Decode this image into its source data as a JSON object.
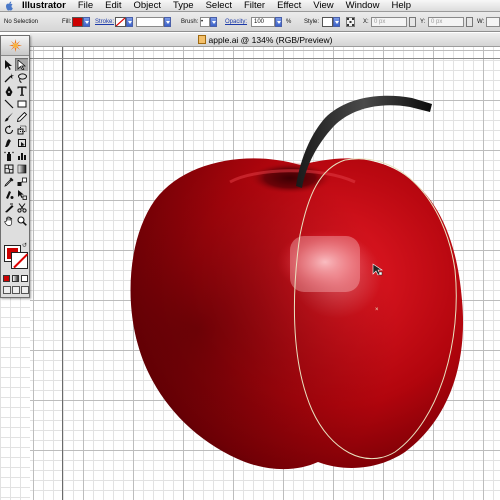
{
  "menubar": {
    "app_name": "Illustrator",
    "items": [
      "File",
      "Edit",
      "Object",
      "Type",
      "Select",
      "Filter",
      "Effect",
      "View",
      "Window",
      "Help"
    ]
  },
  "control": {
    "selection_status": "No Selection",
    "fill_label": "Fill:",
    "stroke_label": "Stroke:",
    "brush_label": "Brush:",
    "opacity_label": "Opacity:",
    "opacity_value": "100",
    "percent": "%",
    "style_label": "Style:",
    "x_label": "X:",
    "x_value": "0 px",
    "y_label": "Y:",
    "y_value": "0 px",
    "w_label": "W:",
    "fill_color": "#cc0000"
  },
  "document": {
    "title": "apple.ai @ 134% (RGB/Preview)"
  },
  "tools": {
    "fill_color": "#cc0000",
    "stroke_color": "#ffffff",
    "icons": [
      "selection-tool",
      "direct-selection-tool",
      "magic-wand-tool",
      "lasso-tool",
      "pen-tool",
      "type-tool",
      "line-tool",
      "rectangle-tool",
      "paintbrush-tool",
      "pencil-tool",
      "rotate-tool",
      "scale-tool",
      "warp-tool",
      "free-transform-tool",
      "symbol-sprayer-tool",
      "graph-tool",
      "mesh-tool",
      "gradient-tool",
      "eyedropper-tool",
      "blend-tool",
      "live-paint-tool",
      "live-paint-selection-tool",
      "slice-tool",
      "scissors-tool",
      "hand-tool",
      "zoom-tool"
    ]
  },
  "colors": {
    "apple_red": "#c40a12",
    "apple_dark": "#5a0004",
    "selection_path": "#e0d9b8"
  }
}
